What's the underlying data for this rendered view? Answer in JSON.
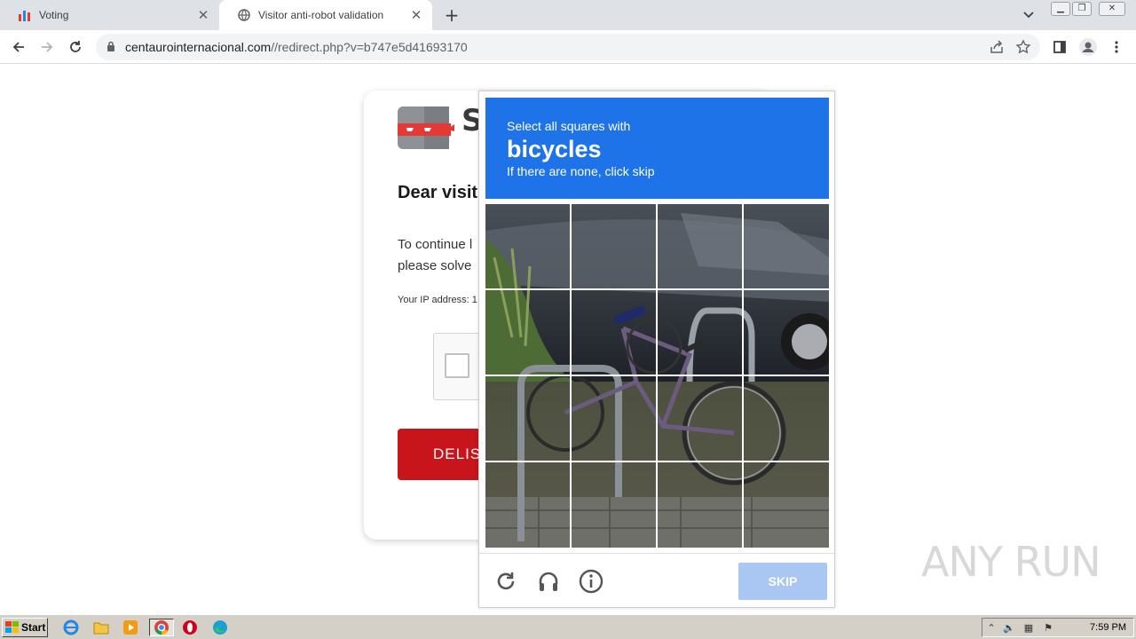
{
  "browser": {
    "tabs": [
      {
        "title": "Voting",
        "active": false,
        "icon": "chart-favicon-icon"
      },
      {
        "title": "Visitor anti-robot validation",
        "active": true,
        "icon": "globe-icon"
      }
    ],
    "url": {
      "host": "centaurointernacional.com",
      "path": "//redirect.php?v=b747e5d41693170"
    }
  },
  "page": {
    "heading": "Dear visit",
    "paragraph_line1": "To continue l",
    "paragraph_line2": "please solve",
    "ip_label": "Your IP address: 1",
    "button_label": "DELIS",
    "logo_letter": "S"
  },
  "captcha": {
    "prompt_line1": "Select all squares with",
    "target": "bicycles",
    "prompt_line3": "If there are none, click skip",
    "skip_label": "SKIP",
    "grid_size": 4,
    "colors": {
      "header": "#1e73e8",
      "skip": "#a9c7f2"
    }
  },
  "watermark": "ANY RUN",
  "taskbar": {
    "start_label": "Start",
    "clock": "7:59 PM"
  }
}
